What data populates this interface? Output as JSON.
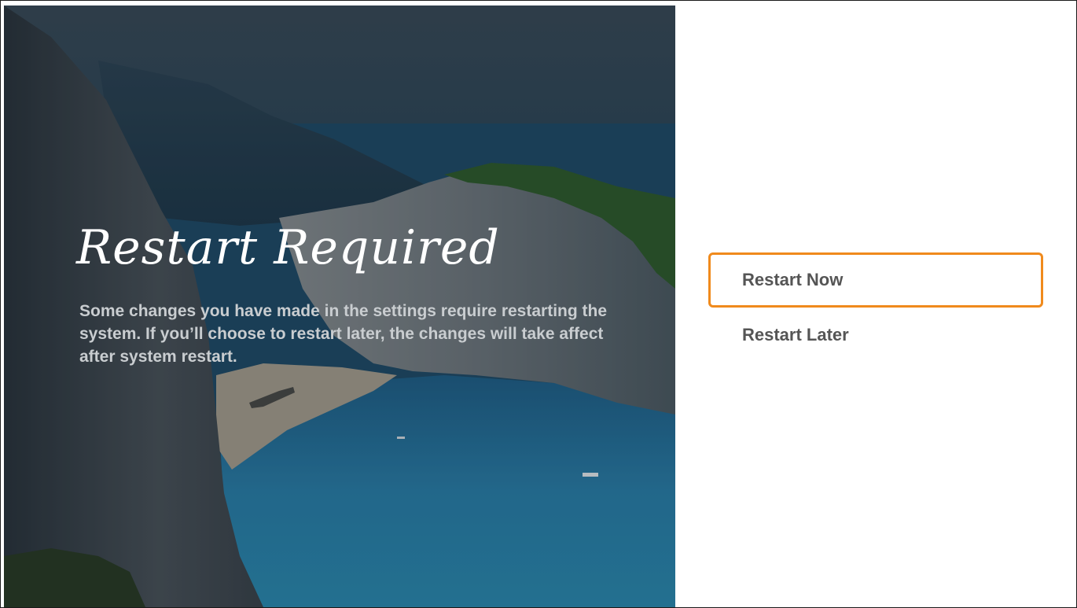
{
  "dialog": {
    "title": "Restart Required",
    "message": "Some changes you have made in the settings require restarting the system. If you’ll choose to restart later, the changes will take affect after system restart."
  },
  "options": [
    {
      "label": "Restart Now",
      "focused": true
    },
    {
      "label": "Restart Later",
      "focused": false
    }
  ],
  "colors": {
    "focus_border": "#f08a1c",
    "option_text": "#555555",
    "message_text": "#c9cdd0",
    "title_text": "#ffffff"
  }
}
